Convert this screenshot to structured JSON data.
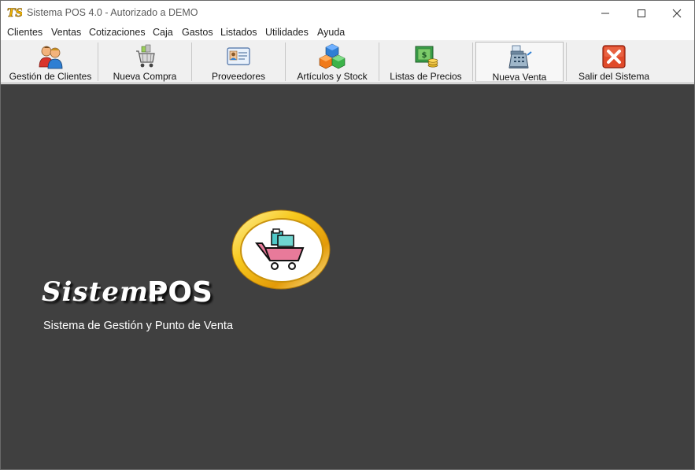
{
  "window": {
    "title": "Sistema POS 4.0 - Autorizado a DEMO",
    "app_icon_text": "TS"
  },
  "menu": {
    "items": [
      "Clientes",
      "Ventas",
      "Cotizaciones",
      "Caja",
      "Gastos",
      "Listados",
      "Utilidades",
      "Ayuda"
    ]
  },
  "toolbar": {
    "buttons": [
      {
        "label": "Gestión de Clientes",
        "icon": "users-icon"
      },
      {
        "label": "Nueva Compra",
        "icon": "shopping-cart-icon"
      },
      {
        "label": "Proveedores",
        "icon": "id-card-icon"
      },
      {
        "label": "Artículos y Stock",
        "icon": "cubes-icon"
      },
      {
        "label": "Listas de Precios",
        "icon": "money-icon"
      },
      {
        "label": "Nueva Venta",
        "icon": "cash-register-icon"
      },
      {
        "label": "Salir del Sistema",
        "icon": "exit-icon"
      }
    ]
  },
  "main": {
    "brand_script": "Sistema",
    "brand_bold": "POS",
    "subtitle": "Sistema de Gestión y Punto de Venta"
  },
  "colors": {
    "main_background": "#404040",
    "toolbar_background": "#f0f0f0",
    "logo_gold": "#f2c12e",
    "exit_red": "#e04a2a"
  }
}
